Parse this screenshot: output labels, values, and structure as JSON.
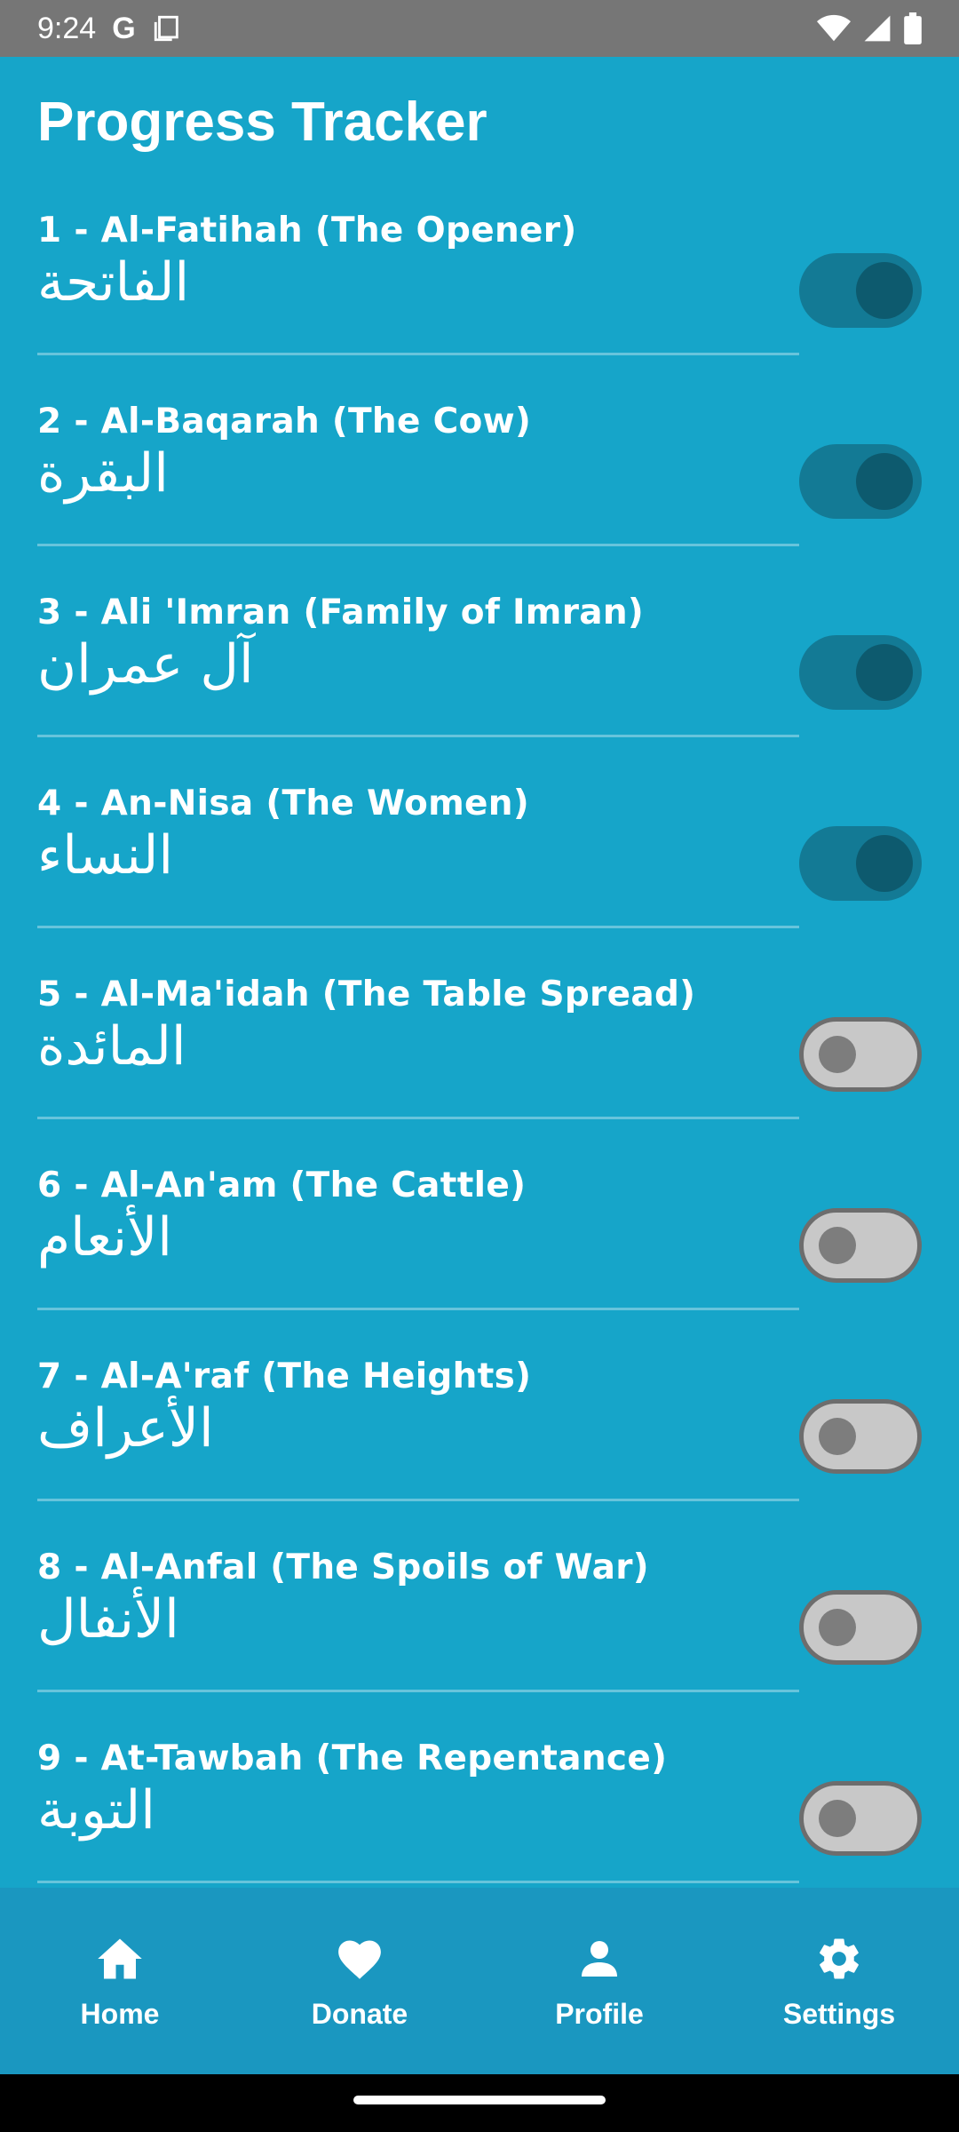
{
  "status_bar": {
    "time": "9:24",
    "google_icon": "G"
  },
  "title": "Progress Tracker",
  "surahs": [
    {
      "title": "1 - Al-Fatihah (The Opener)",
      "arabic": "الفاتحة",
      "completed": true
    },
    {
      "title": "2 - Al-Baqarah (The Cow)",
      "arabic": "البقرة",
      "completed": true
    },
    {
      "title": "3 - Ali 'Imran (Family of Imran)",
      "arabic": "آل عمران",
      "completed": true
    },
    {
      "title": "4 - An-Nisa (The Women)",
      "arabic": "النساء",
      "completed": true
    },
    {
      "title": "5 - Al-Ma'idah (The Table Spread)",
      "arabic": "المائدة",
      "completed": false
    },
    {
      "title": "6 - Al-An'am (The Cattle)",
      "arabic": "الأنعام",
      "completed": false
    },
    {
      "title": "7 - Al-A'raf (The Heights)",
      "arabic": "الأعراف",
      "completed": false
    },
    {
      "title": "8 - Al-Anfal (The Spoils of War)",
      "arabic": "الأنفال",
      "completed": false
    },
    {
      "title": "9 - At-Tawbah (The Repentance)",
      "arabic": "التوبة",
      "completed": false
    }
  ],
  "nav": {
    "home": "Home",
    "donate": "Donate",
    "profile": "Profile",
    "settings": "Settings"
  },
  "colors": {
    "background": "#16a5c9",
    "nav_background": "#1a97c0",
    "toggle_on_track": "#137a95",
    "toggle_on_thumb": "#0d5a6e",
    "toggle_off_track": "#c8c8c8"
  }
}
